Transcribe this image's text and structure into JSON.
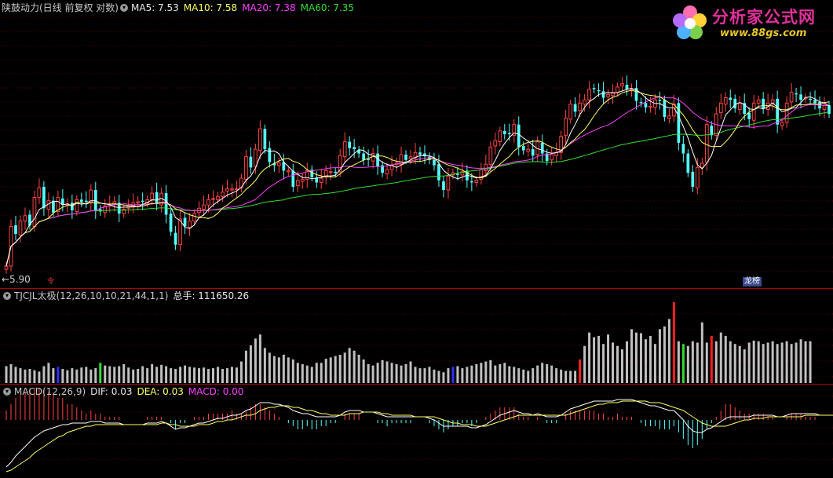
{
  "main_header": {
    "title": "陕鼓动力(日线 前复权 对数)",
    "ma5": "MA5: 7.53",
    "ma10": "MA10: 7.58",
    "ma20": "MA20: 7.38",
    "ma60": "MA60: 7.35"
  },
  "price_low_label": "←5.90",
  "badge_left": "令",
  "badge_right": "龙榜",
  "indicator_header": {
    "name": "TJCJL太极(12,26,10,10,21,44,1,1)",
    "total": "总手: 111650.26"
  },
  "macd_header": {
    "name": "MACD(12,26,9)",
    "dif": "DIF: 0.03",
    "dea": "DEA: 0.03",
    "macd": "MACD: 0.00"
  },
  "logo": {
    "brand": "分析家公式网",
    "url": "www.88gs.com"
  },
  "colors": {
    "up": "#ff4444",
    "down": "#54ffff",
    "ma5": "#ffffff",
    "ma10": "#ffff66",
    "ma20": "#ff40ff",
    "ma60": "#33dd33",
    "vol_bar": "#c0c0c0",
    "separator": "#b00000"
  },
  "chart_data": [
    {
      "type": "candlestick",
      "title": "陕鼓动力(日线 前复权 对数)",
      "ylim": [
        5.9,
        8.3
      ],
      "x": [
        1,
        2,
        3,
        4,
        5,
        6,
        7,
        8,
        9,
        10,
        11,
        12,
        13,
        14,
        15,
        16,
        17,
        18,
        19,
        20,
        21,
        22,
        23,
        24,
        25,
        26,
        27,
        28,
        29,
        30,
        31,
        32,
        33,
        34,
        35,
        36,
        37,
        38,
        39,
        40,
        41,
        42,
        43,
        44,
        45,
        46,
        47,
        48,
        49,
        50,
        51,
        52,
        53,
        54,
        55,
        56,
        57,
        58,
        59,
        60,
        61,
        62,
        63,
        64,
        65,
        66,
        67,
        68,
        69,
        70,
        71,
        72,
        73,
        74,
        75,
        76,
        77,
        78,
        79,
        80,
        81,
        82,
        83,
        84,
        85,
        86,
        87,
        88,
        89,
        90,
        91,
        92,
        93,
        94,
        95,
        96,
        97,
        98,
        99,
        100,
        101,
        102,
        103,
        104,
        105,
        106,
        107,
        108,
        109,
        110,
        111,
        112,
        113,
        114,
        115,
        116,
        117,
        118,
        119,
        120,
        121,
        122,
        123,
        124,
        125,
        126,
        127,
        128,
        129,
        130,
        131,
        132,
        133,
        134,
        135,
        136,
        137,
        138,
        139,
        140,
        141,
        142,
        143,
        144,
        145,
        146,
        147,
        148,
        149,
        150,
        151,
        152,
        153,
        154,
        155,
        156,
        157,
        158,
        159,
        160,
        161,
        162,
        163,
        164,
        165,
        166,
        167,
        168,
        169,
        170,
        171,
        172
      ],
      "close": [
        5.98,
        6.35,
        6.28,
        6.4,
        6.45,
        6.36,
        6.62,
        6.71,
        6.52,
        6.59,
        6.48,
        6.62,
        6.55,
        6.56,
        6.5,
        6.6,
        6.58,
        6.58,
        6.69,
        6.5,
        6.49,
        6.54,
        6.55,
        6.58,
        6.47,
        6.51,
        6.54,
        6.57,
        6.58,
        6.58,
        6.6,
        6.66,
        6.56,
        6.66,
        6.46,
        6.3,
        6.18,
        6.42,
        6.35,
        6.4,
        6.47,
        6.52,
        6.55,
        6.6,
        6.61,
        6.63,
        6.67,
        6.7,
        6.7,
        6.7,
        6.8,
        7.0,
        6.9,
        7.07,
        7.26,
        7.07,
        6.95,
        6.92,
        6.94,
        6.87,
        6.87,
        6.72,
        6.78,
        6.79,
        6.87,
        6.81,
        6.76,
        6.8,
        6.87,
        6.86,
        6.85,
        7.01,
        7.14,
        7.08,
        7.07,
        7.03,
        6.97,
        6.97,
        7.03,
        6.91,
        6.85,
        6.88,
        6.92,
        6.94,
        7.02,
        6.97,
        7.0,
        7.04,
        7.02,
        7.01,
        6.97,
        6.92,
        6.78,
        6.69,
        6.82,
        6.85,
        6.83,
        6.86,
        6.78,
        6.76,
        6.78,
        6.88,
        6.93,
        7.09,
        7.15,
        7.24,
        7.21,
        7.21,
        7.3,
        7.09,
        7.06,
        7.07,
        7.01,
        7.14,
        7.03,
        6.96,
        7.02,
        7.04,
        7.19,
        7.36,
        7.49,
        7.42,
        7.5,
        7.53,
        7.63,
        7.63,
        7.61,
        7.55,
        7.58,
        7.6,
        7.65,
        7.68,
        7.63,
        7.63,
        7.52,
        7.5,
        7.46,
        7.47,
        7.53,
        7.52,
        7.37,
        7.38,
        7.49,
        7.13,
        7.03,
        6.85,
        6.72,
        6.9,
        6.94,
        7.3,
        7.2,
        7.4,
        7.5,
        7.55,
        7.53,
        7.45,
        7.5,
        7.4,
        7.35,
        7.5,
        7.53,
        7.45,
        7.5,
        7.53,
        7.3,
        7.32,
        7.5,
        7.6,
        7.58,
        7.53,
        7.55,
        7.53,
        7.5,
        7.45,
        7.48,
        7.4
      ]
    },
    {
      "type": "bar",
      "title": "TJCJL太极(12,26,10,10,21,44,1,1)",
      "annotations": [
        "总手: 111650.26"
      ],
      "ylim": [
        0,
        120000
      ],
      "values": [
        25000,
        28000,
        24000,
        22000,
        20000,
        21000,
        19000,
        17000,
        25000,
        30000,
        22000,
        24000,
        21000,
        19000,
        22000,
        20000,
        23000,
        24000,
        20000,
        22000,
        30000,
        26000,
        25000,
        24000,
        25000,
        28000,
        23000,
        20000,
        21000,
        25000,
        22000,
        28000,
        24000,
        27000,
        25000,
        22000,
        21000,
        24000,
        26000,
        24000,
        23000,
        22000,
        23000,
        21000,
        22000,
        24000,
        21000,
        22000,
        24000,
        23000,
        32000,
        48000,
        56000,
        66000,
        72000,
        52000,
        45000,
        40000,
        38000,
        42000,
        38000,
        35000,
        30000,
        28000,
        26000,
        24000,
        30000,
        30000,
        36000,
        38000,
        40000,
        42000,
        45000,
        52000,
        48000,
        42000,
        35000,
        28000,
        26000,
        30000,
        34000,
        32000,
        30000,
        28000,
        26000,
        28000,
        32000,
        24000,
        22000,
        22000,
        24000,
        20000,
        18000,
        16000,
        22000,
        24000,
        25000,
        22000,
        24000,
        26000,
        28000,
        30000,
        32000,
        34000,
        26000,
        28000,
        30000,
        25000,
        24000,
        22000,
        20000,
        18000,
        22000,
        26000,
        30000,
        28000,
        26000,
        22000,
        20000,
        18000,
        18000,
        18000,
        35000,
        55000,
        75000,
        68000,
        70000,
        58000,
        72000,
        60000,
        55000,
        50000,
        62000,
        80000,
        75000,
        74000,
        65000,
        70000,
        58000,
        80000,
        84000,
        95000,
        120000,
        62000,
        58000,
        55000,
        62000,
        60000,
        90000,
        60000,
        70000,
        62000,
        75000,
        70000,
        62000,
        58000,
        55000,
        50000,
        60000,
        63000,
        62000,
        58000,
        60000,
        62000,
        58000,
        60000,
        62000,
        58000,
        60000,
        65000,
        62000,
        62000
      ]
    },
    {
      "type": "line",
      "title": "MACD(12,26,9)",
      "series": [
        {
          "name": "DIF",
          "values": [
            -0.3,
            -0.27,
            -0.23,
            -0.2,
            -0.17,
            -0.14,
            -0.11,
            -0.09,
            -0.07,
            -0.06,
            -0.05,
            -0.04,
            -0.03,
            -0.03,
            -0.02,
            -0.02,
            -0.02,
            -0.02,
            -0.01,
            -0.01,
            -0.01,
            -0.02,
            -0.02,
            -0.02,
            -0.02,
            -0.03,
            -0.03,
            -0.03,
            -0.03,
            -0.03,
            -0.02,
            -0.02,
            -0.02,
            -0.01,
            -0.02,
            -0.04,
            -0.06,
            -0.05,
            -0.05,
            -0.04,
            -0.03,
            -0.02,
            -0.02,
            -0.01,
            0.0,
            0.01,
            0.01,
            0.02,
            0.03,
            0.03,
            0.04,
            0.06,
            0.07,
            0.09,
            0.11,
            0.11,
            0.11,
            0.1,
            0.1,
            0.09,
            0.08,
            0.06,
            0.05,
            0.04,
            0.04,
            0.03,
            0.02,
            0.02,
            0.02,
            0.02,
            0.02,
            0.03,
            0.05,
            0.06,
            0.06,
            0.06,
            0.05,
            0.05,
            0.05,
            0.04,
            0.03,
            0.02,
            0.02,
            0.02,
            0.02,
            0.02,
            0.02,
            0.02,
            0.02,
            0.02,
            0.01,
            0.0,
            -0.02,
            -0.04,
            -0.04,
            -0.04,
            -0.04,
            -0.04,
            -0.04,
            -0.05,
            -0.05,
            -0.04,
            -0.03,
            -0.01,
            0.01,
            0.03,
            0.04,
            0.05,
            0.06,
            0.05,
            0.04,
            0.04,
            0.03,
            0.04,
            0.03,
            0.02,
            0.02,
            0.02,
            0.03,
            0.05,
            0.07,
            0.08,
            0.09,
            0.1,
            0.11,
            0.12,
            0.12,
            0.12,
            0.12,
            0.12,
            0.13,
            0.13,
            0.13,
            0.13,
            0.12,
            0.11,
            0.1,
            0.09,
            0.09,
            0.08,
            0.07,
            0.06,
            0.06,
            0.03,
            0.0,
            -0.04,
            -0.07,
            -0.08,
            -0.08,
            -0.06,
            -0.05,
            -0.03,
            -0.01,
            0.01,
            0.02,
            0.02,
            0.02,
            0.02,
            0.02,
            0.03,
            0.03,
            0.03,
            0.03,
            0.03,
            0.02,
            0.02,
            0.03,
            0.04,
            0.04,
            0.04,
            0.04,
            0.04,
            0.04,
            0.03,
            0.03,
            0.03
          ]
        },
        {
          "name": "DEA",
          "values": [
            -0.33,
            -0.32,
            -0.3,
            -0.28,
            -0.26,
            -0.24,
            -0.21,
            -0.19,
            -0.17,
            -0.15,
            -0.13,
            -0.11,
            -0.1,
            -0.08,
            -0.07,
            -0.06,
            -0.05,
            -0.04,
            -0.04,
            -0.03,
            -0.03,
            -0.03,
            -0.03,
            -0.03,
            -0.03,
            -0.03,
            -0.03,
            -0.03,
            -0.03,
            -0.03,
            -0.03,
            -0.03,
            -0.03,
            -0.02,
            -0.02,
            -0.03,
            -0.03,
            -0.04,
            -0.04,
            -0.04,
            -0.04,
            -0.03,
            -0.03,
            -0.03,
            -0.02,
            -0.01,
            -0.01,
            0.0,
            0.0,
            0.01,
            0.02,
            0.03,
            0.03,
            0.04,
            0.06,
            0.07,
            0.08,
            0.08,
            0.09,
            0.09,
            0.09,
            0.08,
            0.08,
            0.07,
            0.06,
            0.06,
            0.05,
            0.04,
            0.04,
            0.03,
            0.03,
            0.03,
            0.03,
            0.04,
            0.04,
            0.04,
            0.05,
            0.05,
            0.05,
            0.05,
            0.04,
            0.04,
            0.03,
            0.03,
            0.03,
            0.03,
            0.03,
            0.02,
            0.02,
            0.02,
            0.02,
            0.02,
            0.01,
            0.0,
            -0.01,
            -0.02,
            -0.02,
            -0.03,
            -0.03,
            -0.03,
            -0.04,
            -0.04,
            -0.04,
            -0.03,
            -0.02,
            -0.01,
            0.0,
            0.01,
            0.02,
            0.03,
            0.03,
            0.03,
            0.03,
            0.03,
            0.03,
            0.03,
            0.03,
            0.03,
            0.03,
            0.03,
            0.04,
            0.05,
            0.06,
            0.07,
            0.08,
            0.09,
            0.1,
            0.1,
            0.11,
            0.11,
            0.11,
            0.12,
            0.12,
            0.12,
            0.12,
            0.12,
            0.12,
            0.11,
            0.11,
            0.11,
            0.1,
            0.09,
            0.08,
            0.07,
            0.06,
            0.04,
            0.02,
            0.0,
            -0.02,
            -0.03,
            -0.04,
            -0.04,
            -0.04,
            -0.04,
            -0.03,
            -0.02,
            -0.01,
            0.0,
            0.0,
            0.01,
            0.01,
            0.01,
            0.02,
            0.02,
            0.02,
            0.02,
            0.02,
            0.02,
            0.02,
            0.02,
            0.03,
            0.03,
            0.03,
            0.03,
            0.03,
            0.03,
            0.03,
            0.03
          ]
        }
      ]
    }
  ]
}
